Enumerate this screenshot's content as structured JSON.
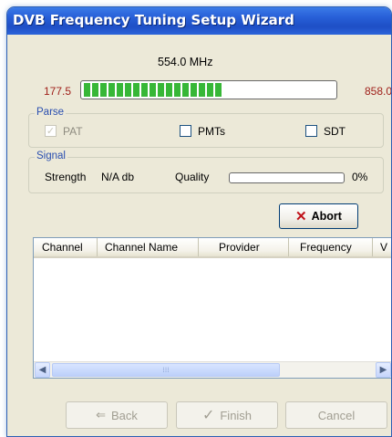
{
  "window": {
    "title": "DVB Frequency Tuning Setup Wizard"
  },
  "frequency": {
    "current": "554.0 MHz",
    "min": "177.5",
    "max": "858.0",
    "progress_fraction": 0.55
  },
  "parse": {
    "label": "Parse",
    "options": [
      {
        "label": "PAT",
        "checked": true,
        "disabled": true
      },
      {
        "label": "PMTs",
        "checked": false,
        "disabled": false
      },
      {
        "label": "SDT",
        "checked": false,
        "disabled": false
      }
    ]
  },
  "signal": {
    "label": "Signal",
    "strength_label": "Strength",
    "strength_value": "N/A db",
    "quality_label": "Quality",
    "quality_value": "0%",
    "quality_fraction": 0
  },
  "abort_button": {
    "label": "Abort",
    "icon": "red-x-icon"
  },
  "channel_list": {
    "columns": [
      "Channel",
      "Channel Name",
      "Provider",
      "Frequency",
      "V"
    ],
    "rows": []
  },
  "footer": {
    "back_label": "Back",
    "finish_label": "Finish",
    "cancel_label": "Cancel"
  },
  "colors": {
    "titlebar": "#2860D8",
    "progress_fill": "#37B737",
    "range_text": "#A0211B",
    "abort_icon": "#C0121A"
  }
}
